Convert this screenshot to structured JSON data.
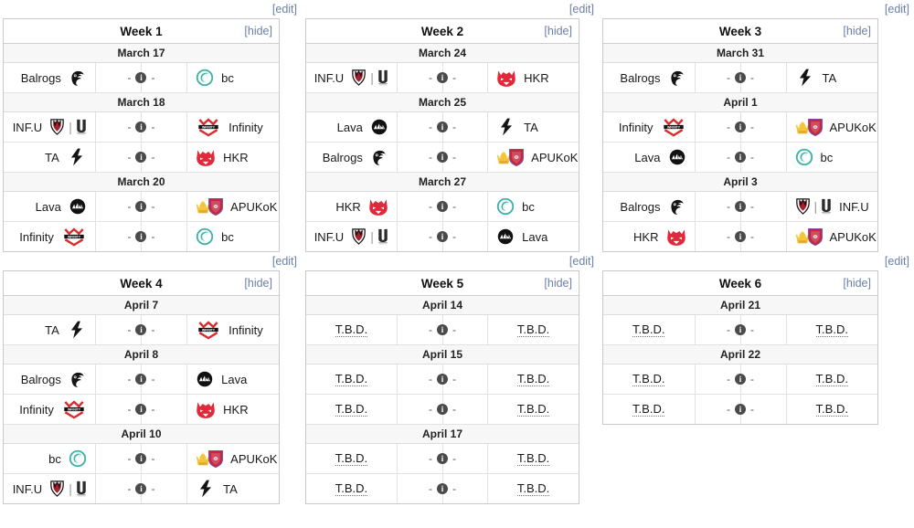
{
  "page": {
    "edit_label": "[edit]",
    "hide_label": "[hide]",
    "tbd_label": "T.B.D.",
    "dash": "-",
    "info_glyph": "i"
  },
  "colors": {
    "link": "#6b7fa8",
    "edit_link": "#6b7fa8",
    "border": "#c8c8c8",
    "date_row_bg": "#f7f7f7",
    "header_bg": "#ffffff",
    "hkr_red": "#e0293a",
    "infinity_red": "#d92b2b",
    "bc_teal": "#3fb3a8",
    "lava_black": "#111111",
    "balrogs_black": "#141414",
    "ta_black": "#141414",
    "apukok_gold": "#f2c53d",
    "apukok_shield": "#c6273f",
    "infu_red": "#a81f2e"
  },
  "teams": {
    "balrogs": {
      "name": "Balrogs",
      "logo": "balrogs-logo"
    },
    "bc": {
      "name": "bc",
      "logo": "bc-logo"
    },
    "infu": {
      "name": "INF.U",
      "logo": "infu-logo"
    },
    "infinity": {
      "name": "Infinity",
      "logo": "infinity-logo"
    },
    "ta": {
      "name": "TA",
      "logo": "ta-logo"
    },
    "hkr": {
      "name": "HKR",
      "logo": "hkr-logo"
    },
    "lava": {
      "name": "Lava",
      "logo": "lava-logo"
    },
    "apukok": {
      "name": "APUKoK",
      "logo": "apukok-logo"
    },
    "tbd": {
      "name": "T.B.D.",
      "logo": "none"
    }
  },
  "weeks": [
    {
      "id": "week-1",
      "title": "Week 1",
      "days": [
        {
          "date": "March 17",
          "matches": [
            {
              "left": "Balrogs",
              "left_logo": "balrogs-logo",
              "right": "bc",
              "right_logo": "bc-logo",
              "score": "- i -"
            }
          ]
        },
        {
          "date": "March 18",
          "matches": [
            {
              "left": "INF.U",
              "left_logo": "infu-logo",
              "right": "Infinity",
              "right_logo": "infinity-logo",
              "score": "- i -"
            },
            {
              "left": "TA",
              "left_logo": "ta-logo",
              "right": "HKR",
              "right_logo": "hkr-logo",
              "score": "- i -"
            }
          ]
        },
        {
          "date": "March 20",
          "matches": [
            {
              "left": "Lava",
              "left_logo": "lava-logo",
              "right": "APUKoK",
              "right_logo": "apukok-logo",
              "score": "- i -"
            },
            {
              "left": "Infinity",
              "left_logo": "infinity-logo",
              "right": "bc",
              "right_logo": "bc-logo",
              "score": "- i -"
            }
          ]
        }
      ]
    },
    {
      "id": "week-2",
      "title": "Week 2",
      "days": [
        {
          "date": "March 24",
          "matches": [
            {
              "left": "INF.U",
              "left_logo": "infu-logo",
              "right": "HKR",
              "right_logo": "hkr-logo",
              "score": "- i -"
            }
          ]
        },
        {
          "date": "March 25",
          "matches": [
            {
              "left": "Lava",
              "left_logo": "lava-logo",
              "right": "TA",
              "right_logo": "ta-logo",
              "score": "- i -"
            },
            {
              "left": "Balrogs",
              "left_logo": "balrogs-logo",
              "right": "APUKoK",
              "right_logo": "apukok-logo",
              "score": "- i -"
            }
          ]
        },
        {
          "date": "March 27",
          "matches": [
            {
              "left": "HKR",
              "left_logo": "hkr-logo",
              "right": "bc",
              "right_logo": "bc-logo",
              "score": "- i -"
            },
            {
              "left": "INF.U",
              "left_logo": "infu-logo",
              "right": "Lava",
              "right_logo": "lava-logo",
              "score": "- i -"
            }
          ]
        }
      ]
    },
    {
      "id": "week-3",
      "title": "Week 3",
      "days": [
        {
          "date": "March 31",
          "matches": [
            {
              "left": "Balrogs",
              "left_logo": "balrogs-logo",
              "right": "TA",
              "right_logo": "ta-logo",
              "score": "- i -"
            }
          ]
        },
        {
          "date": "April 1",
          "matches": [
            {
              "left": "Infinity",
              "left_logo": "infinity-logo",
              "right": "APUKoK",
              "right_logo": "apukok-logo",
              "score": "- i -"
            },
            {
              "left": "Lava",
              "left_logo": "lava-logo",
              "right": "bc",
              "right_logo": "bc-logo",
              "score": "- i -"
            }
          ]
        },
        {
          "date": "April 3",
          "matches": [
            {
              "left": "Balrogs",
              "left_logo": "balrogs-logo",
              "right": "INF.U",
              "right_logo": "infu-logo",
              "score": "- i -"
            },
            {
              "left": "HKR",
              "left_logo": "hkr-logo",
              "right": "APUKoK",
              "right_logo": "apukok-logo",
              "score": "- i -"
            }
          ]
        }
      ]
    },
    {
      "id": "week-4",
      "title": "Week 4",
      "days": [
        {
          "date": "April 7",
          "matches": [
            {
              "left": "TA",
              "left_logo": "ta-logo",
              "right": "Infinity",
              "right_logo": "infinity-logo",
              "score": "- i -"
            }
          ]
        },
        {
          "date": "April 8",
          "matches": [
            {
              "left": "Balrogs",
              "left_logo": "balrogs-logo",
              "right": "Lava",
              "right_logo": "lava-logo",
              "score": "- i -"
            },
            {
              "left": "Infinity",
              "left_logo": "infinity-logo",
              "right": "HKR",
              "right_logo": "hkr-logo",
              "score": "- i -"
            }
          ]
        },
        {
          "date": "April 10",
          "matches": [
            {
              "left": "bc",
              "left_logo": "bc-logo",
              "right": "APUKoK",
              "right_logo": "apukok-logo",
              "score": "- i -"
            },
            {
              "left": "INF.U",
              "left_logo": "infu-logo",
              "right": "TA",
              "right_logo": "ta-logo",
              "score": "- i -"
            }
          ]
        }
      ]
    },
    {
      "id": "week-5",
      "title": "Week 5",
      "days": [
        {
          "date": "April 14",
          "matches": [
            {
              "left": "T.B.D.",
              "left_logo": "none",
              "right": "T.B.D.",
              "right_logo": "none",
              "score": "- i -"
            }
          ]
        },
        {
          "date": "April 15",
          "matches": [
            {
              "left": "T.B.D.",
              "left_logo": "none",
              "right": "T.B.D.",
              "right_logo": "none",
              "score": "- i -"
            },
            {
              "left": "T.B.D.",
              "left_logo": "none",
              "right": "T.B.D.",
              "right_logo": "none",
              "score": "- i -"
            }
          ]
        },
        {
          "date": "April 17",
          "matches": [
            {
              "left": "T.B.D.",
              "left_logo": "none",
              "right": "T.B.D.",
              "right_logo": "none",
              "score": "- i -"
            },
            {
              "left": "T.B.D.",
              "left_logo": "none",
              "right": "T.B.D.",
              "right_logo": "none",
              "score": "- i -"
            }
          ]
        }
      ]
    },
    {
      "id": "week-6",
      "title": "Week 6",
      "days": [
        {
          "date": "April 21",
          "matches": [
            {
              "left": "T.B.D.",
              "left_logo": "none",
              "right": "T.B.D.",
              "right_logo": "none",
              "score": "- i -"
            }
          ]
        },
        {
          "date": "April 22",
          "matches": [
            {
              "left": "T.B.D.",
              "left_logo": "none",
              "right": "T.B.D.",
              "right_logo": "none",
              "score": "- i -"
            },
            {
              "left": "T.B.D.",
              "left_logo": "none",
              "right": "T.B.D.",
              "right_logo": "none",
              "score": "- i -"
            }
          ]
        }
      ]
    }
  ]
}
